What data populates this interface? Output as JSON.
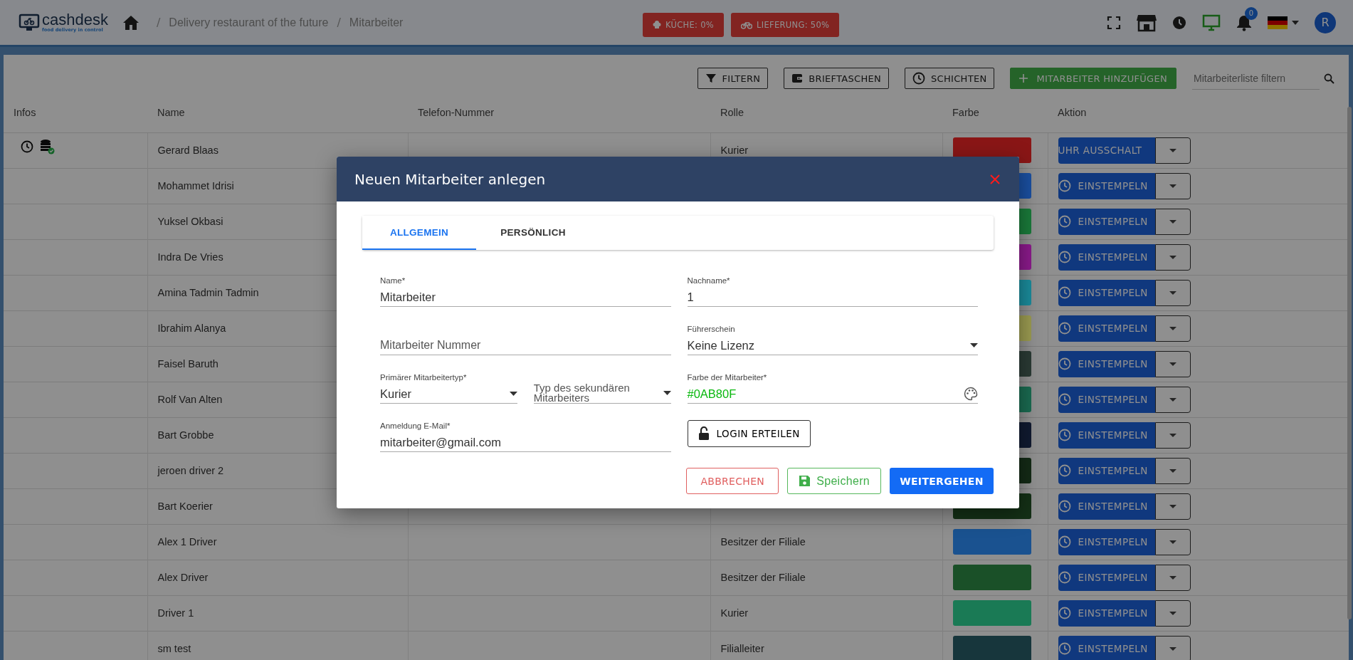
{
  "header": {
    "logo": {
      "name": "cashdesk",
      "tagline": "food delivery in control"
    },
    "breadcrumb_separator": "/",
    "breadcrumbs": [
      "Delivery restaurant of the future",
      "Mitarbeiter"
    ],
    "status_badges": [
      {
        "kind": "kitchen",
        "label": "KÜCHE: 0%"
      },
      {
        "kind": "delivery",
        "label": "LIEFERUNG: 50%"
      }
    ],
    "notification_count": "0",
    "avatar": "R"
  },
  "toolbar": {
    "buttons": [
      {
        "kind": "filter",
        "label": "FILTERN"
      },
      {
        "kind": "wallet",
        "label": "BRIEFTASCHEN"
      },
      {
        "kind": "shifts",
        "label": "SCHICHTEN"
      },
      {
        "kind": "add",
        "label": "MITARBEITER HINZUFÜGEN"
      }
    ],
    "search": {
      "placeholder": "Mitarbeiterliste filtern"
    }
  },
  "table": {
    "columns": [
      "Infos",
      "Name",
      "Telefon-Nummer",
      "Rolle",
      "Farbe",
      "Aktion"
    ],
    "rows": [
      {
        "clocked_in": true,
        "name": "Gerard Blaas",
        "role": "Kurier",
        "color": "#8a1616",
        "action": {
          "kind": "clock_out",
          "label": "UHR AUSSCHALT"
        }
      },
      {
        "clocked_in": false,
        "name": "Mohammet Idrisi",
        "color": "#1a4fa0",
        "action": {
          "kind": "clock_in",
          "label": "EINSTEMPELN"
        }
      },
      {
        "clocked_in": false,
        "name": "Yuksel Okbasi",
        "color": "#1a7a3a",
        "action": {
          "kind": "clock_in",
          "label": "EINSTEMPELN"
        }
      },
      {
        "clocked_in": false,
        "name": "Indra De Vries",
        "color": "#8a1a8a",
        "action": {
          "kind": "clock_in",
          "label": "EINSTEMPELN"
        }
      },
      {
        "clocked_in": false,
        "name": "Amina Tadmin Tadmin",
        "color": "#1a8a9a",
        "action": {
          "kind": "clock_in",
          "label": "EINSTEMPELN"
        }
      },
      {
        "clocked_in": false,
        "name": "Ibrahim Alanya",
        "color": "#9a9a50",
        "action": {
          "kind": "clock_in",
          "label": "EINSTEMPELN"
        }
      },
      {
        "clocked_in": false,
        "name": "Faisel Baruth",
        "color": "#2a3a34",
        "action": {
          "kind": "clock_in",
          "label": "EINSTEMPELN"
        }
      },
      {
        "clocked_in": false,
        "name": "Rolf Van Alten",
        "color": "#1a6a50",
        "action": {
          "kind": "clock_in",
          "label": "EINSTEMPELN"
        }
      },
      {
        "clocked_in": false,
        "name": "Bart Grobbe",
        "color": "#101a30",
        "action": {
          "kind": "clock_in",
          "label": "EINSTEMPELN"
        }
      },
      {
        "clocked_in": false,
        "name": "jeroen driver 2",
        "color": "#142a16",
        "action": {
          "kind": "clock_in",
          "label": "EINSTEMPELN"
        }
      },
      {
        "clocked_in": false,
        "name": "Bart Koerier",
        "color": "#143016",
        "action": {
          "kind": "clock_in",
          "label": "EINSTEMPELN"
        }
      },
      {
        "clocked_in": false,
        "name": "Alex 1 Driver",
        "role": "Besitzer der Filiale",
        "color": "#1a5290",
        "action": {
          "kind": "clock_in",
          "label": "EINSTEMPELN"
        }
      },
      {
        "clocked_in": false,
        "name": "Alex Driver",
        "role": "Besitzer der Filiale",
        "color": "#1a5028",
        "action": {
          "kind": "clock_in",
          "label": "EINSTEMPELN"
        }
      },
      {
        "clocked_in": false,
        "name": "Driver 1",
        "role": "Kurier",
        "color": "#1a7a55",
        "action": {
          "kind": "clock_in",
          "label": "EINSTEMPELN"
        }
      },
      {
        "clocked_in": false,
        "name": "sm test",
        "role": "Filialleiter",
        "color": "#17363c",
        "action": {
          "kind": "clock_in",
          "label": "EINSTEMPELN"
        }
      }
    ]
  },
  "modal": {
    "title": "Neuen Mitarbeiter anlegen",
    "tabs": [
      {
        "label": "ALLGEMEIN",
        "selected": true
      },
      {
        "label": "PERSÖNLICH",
        "selected": false
      }
    ],
    "fields": [
      {
        "kind": "text",
        "label": "Name*",
        "value": "Mitarbeiter"
      },
      {
        "kind": "text",
        "label": "Nachname*",
        "value": "1"
      },
      {
        "kind": "text",
        "placeholder": "Mitarbeiter Nummer"
      },
      {
        "kind": "select",
        "label": "Führerschein",
        "value": "Keine Lizenz"
      },
      {
        "kind": "half-select",
        "label": "Primärer Mitarbeitertyp*",
        "value": "Kurier"
      },
      {
        "kind": "half-select",
        "placeholder": "Typ des sekundären Mitarbeiters"
      },
      {
        "kind": "color",
        "label": "Farbe der Mitarbeiter*",
        "value": "#0AB80F"
      },
      {
        "kind": "text",
        "label": "Anmeldung E-Mail*",
        "value": "mitarbeiter@gmail.com"
      },
      {
        "kind": "login-button",
        "label": "LOGIN ERTEILEN"
      }
    ],
    "buttons": [
      {
        "kind": "cancel",
        "label": "ABBRECHEN"
      },
      {
        "kind": "save",
        "label": "Speichern"
      },
      {
        "kind": "continue",
        "label": "WEITERGEHEN"
      }
    ]
  }
}
